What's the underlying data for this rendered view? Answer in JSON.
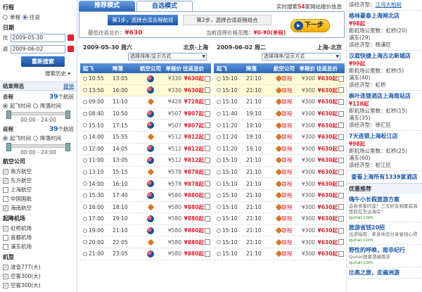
{
  "left": {
    "trip_label": "行程",
    "oneway": "单程",
    "round": "往返",
    "date_label": "日期",
    "go_label": "往",
    "return_label": "返",
    "go_date": "2009-05-30",
    "return_date": "2009-06-02",
    "search_btn": "重新搜索",
    "history": "搜索历史 ▾",
    "filter_title": "结果筛选",
    "cancel": "撤销",
    "go_section": "去程",
    "go_count": "39",
    "count_unit": "个航班",
    "depart_time": "起飞时间",
    "arrive_time": "降落时间",
    "time_range": "00:00 - 24:00",
    "return_section": "返程",
    "return_count": "39",
    "airline_title": "航空公司",
    "airlines": [
      "南方航空",
      "东方航空",
      "上海航空",
      "中国国航",
      "海南航空"
    ],
    "airport_title": "起降机场",
    "airports": [
      "虹桥机场",
      "首都机场",
      "浦东机场"
    ],
    "aircraft_title": "机型",
    "aircraft": [
      "波音777(大)",
      "空客300(大)",
      "空客300(大)"
    ]
  },
  "mid": {
    "tab_recommend": "推荐模式",
    "tab_custom": "自选模式",
    "live_prefix": "实时搜索",
    "live_count": "54",
    "live_suffix": "家网站报价信息",
    "step1": "第1步，选择合适去程航班",
    "step2": "第2步，选择合适返程组合",
    "lowest_label": "最低往返总价：",
    "lowest_price": "¥630",
    "current_label": "当前选择价格范围：",
    "current_range": "¥0-¥0(单程)",
    "next_btn": "下一步",
    "col_left": {
      "date": "2009-05-30 周六",
      "route": "北京-上海",
      "sort": "选择排序/显示方式"
    },
    "col_right": {
      "date": "2009-06-02 周二",
      "route": "上海-北京",
      "sort": "选择排序/显示方式"
    },
    "headers": [
      "起飞",
      "降落",
      "航空公司",
      "单程价",
      "往返总价"
    ],
    "rows_left": [
      {
        "dep": "10:55",
        "arr": "13:05",
        "single": "¥330",
        "total": "¥630起",
        "hl": true
      },
      {
        "dep": "13:50",
        "arr": "16:00",
        "single": "¥330",
        "total": "¥630起",
        "hl": true
      },
      {
        "dep": "09:00",
        "arr": "11:10",
        "single": "¥428",
        "total": "¥728起",
        "hl": false
      },
      {
        "dep": "08:40",
        "arr": "10:50",
        "single": "¥507",
        "total": "¥807起",
        "hl": false
      },
      {
        "dep": "15:10",
        "arr": "17:15",
        "single": "¥507",
        "total": "¥807起",
        "hl": false
      },
      {
        "dep": "14:00",
        "arr": "15:55",
        "single": "¥512",
        "total": "¥812起",
        "hl": false
      },
      {
        "dep": "12:00",
        "arr": "14:05",
        "single": "¥512",
        "total": "¥812起",
        "hl": false
      },
      {
        "dep": "11:00",
        "arr": "13:05",
        "single": "¥512",
        "total": "¥812起",
        "hl": false
      },
      {
        "dep": "13:10",
        "arr": "15:15",
        "single": "¥578",
        "total": "¥878起",
        "hl": false
      },
      {
        "dep": "14:00",
        "arr": "16:10",
        "single": "¥578",
        "total": "¥878起",
        "hl": false
      },
      {
        "dep": "15:30",
        "arr": "17:40",
        "single": "¥580",
        "total": "¥880起",
        "hl": false
      },
      {
        "dep": "16:00",
        "arr": "18:10",
        "single": "¥580",
        "total": "¥880起",
        "hl": false
      },
      {
        "dep": "17:00",
        "arr": "19:10",
        "single": "¥580",
        "total": "¥880起",
        "hl": false
      },
      {
        "dep": "19:00",
        "arr": "21:10",
        "single": "¥580",
        "total": "¥880起",
        "hl": false
      },
      {
        "dep": "20:00",
        "arr": "22:05",
        "single": "¥580",
        "total": "¥880起",
        "hl": false
      },
      {
        "dep": "21:00",
        "arr": "23:05",
        "single": "¥580",
        "total": "¥880起",
        "hl": false
      }
    ],
    "rows_right": [
      {
        "dep": "15:10",
        "arr": "21:10",
        "single": "¥300",
        "total": "¥630起",
        "hl": true
      },
      {
        "dep": "15:10",
        "arr": "21:10",
        "single": "¥300",
        "total": "¥630起",
        "hl": true
      },
      {
        "dep": "15:10",
        "arr": "21:10",
        "single": "¥300",
        "total": "¥630起",
        "hl": false
      },
      {
        "dep": "11:40",
        "arr": "19:10",
        "single": "¥300",
        "total": "¥630起",
        "hl": false
      },
      {
        "dep": "11:20",
        "arr": "19:10",
        "single": "¥300",
        "total": "¥630起",
        "hl": false
      },
      {
        "dep": "11:20",
        "arr": "19:10",
        "single": "¥300",
        "total": "¥630起",
        "hl": false
      },
      {
        "dep": "11:20",
        "arr": "19:10",
        "single": "¥300",
        "total": "¥630起",
        "hl": false
      },
      {
        "dep": "15:10",
        "arr": "21:10",
        "single": "¥300",
        "total": "¥630起",
        "hl": false
      },
      {
        "dep": "15:10",
        "arr": "21:10",
        "single": "¥300",
        "total": "¥630起",
        "hl": false
      },
      {
        "dep": "15:10",
        "arr": "21:10",
        "single": "¥300",
        "total": "¥630起",
        "hl": false
      },
      {
        "dep": "15:10",
        "arr": "21:10",
        "single": "¥300",
        "total": "¥630起",
        "hl": false
      },
      {
        "dep": "15:10",
        "arr": "21:10",
        "single": "¥300",
        "total": "¥630起",
        "hl": false
      },
      {
        "dep": "15:10",
        "arr": "21:10",
        "single": "¥300",
        "total": "¥630起",
        "hl": false
      },
      {
        "dep": "15:10",
        "arr": "21:10",
        "single": "¥300",
        "total": "¥630起",
        "hl": false
      },
      {
        "dep": "15:10",
        "arr": "21:10",
        "single": "¥300",
        "total": "¥630起",
        "hl": false
      },
      {
        "dep": "15:10",
        "arr": "21:10",
        "single": "¥300",
        "total": "¥630起",
        "hl": false
      }
    ],
    "airline_lian": "联程"
  },
  "right": {
    "hotels": [
      {
        "title": "江湾大柏树",
        "price": "",
        "l1": "",
        "l2": ""
      },
      {
        "title": "格林豪泰上海闸北店",
        "price": "¥98起",
        "l1": "距机场公里数：虹桥(20)",
        "l2": "浦东(29)",
        "l3": "该经济型：杨浦区"
      },
      {
        "title": "汉庭快捷上海古北新城店",
        "price": "¥99起",
        "l1": "距机场公里数：虹桥(5)",
        "l2": "浦东(40)",
        "l3": "该经济型：虹桥"
      },
      {
        "title": "枫叶连锁酒店上海南站店",
        "price": "¥118起",
        "l1": "距机场公里数：虹桥(15)",
        "l2": "浦东(35)",
        "l3": "该经济型：徐汇区"
      },
      {
        "title": "7天连锁上海松江店",
        "price": "¥98起",
        "l1": "距机场公里数：虹桥(25)",
        "l2": "浦东(60)",
        "l3": "该经济型：松江区"
      }
    ],
    "viewall": "查看上海所有1339家酒店",
    "promo_title": "优惠推荐",
    "promos": [
      {
        "title": "嗨午小长假旅游方案",
        "desc": "品尝食客的壶！三五好友相聚威海度假在东边海岸！",
        "src": "qunar.com"
      },
      {
        "title": "旅游省钱20招",
        "desc": "出游指南：来身体验分享省钱心得",
        "src": "qunar.com"
      },
      {
        "title": "野性的呼唤，南非纪行",
        "desc": "Qunar搜客游遍南非",
        "src": "qunar.com"
      },
      {
        "title": "比高之旅，走遍洲游",
        "desc": "",
        "src": ""
      }
    ]
  }
}
